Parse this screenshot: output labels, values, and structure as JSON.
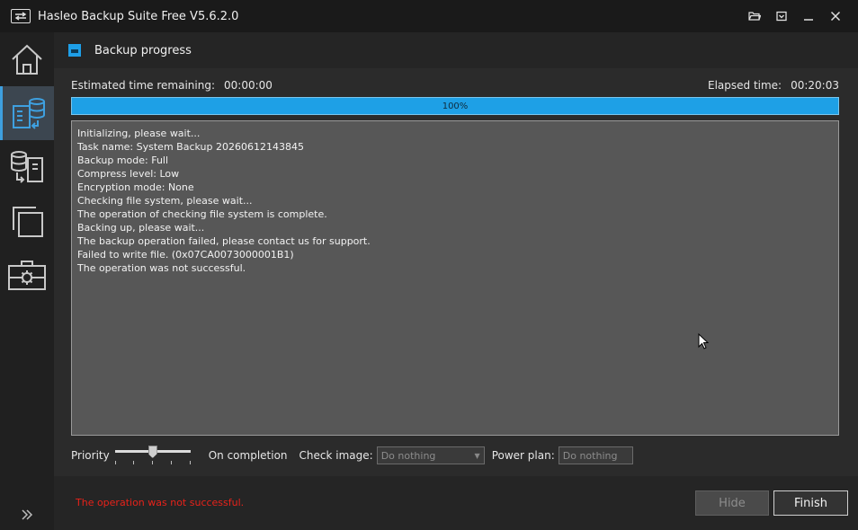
{
  "window": {
    "title": "Hasleo Backup Suite Free V5.6.2.0",
    "icons": [
      "open-folder-icon",
      "maximize-panel-icon",
      "minimize-icon",
      "close-icon"
    ]
  },
  "sidebar": {
    "items": [
      {
        "name": "home",
        "icon": "home-icon",
        "active": false
      },
      {
        "name": "backup",
        "icon": "backup-icon",
        "active": true
      },
      {
        "name": "restore",
        "icon": "restore-icon",
        "active": false
      },
      {
        "name": "clone",
        "icon": "clone-icon",
        "active": false
      },
      {
        "name": "tools",
        "icon": "toolbox-icon",
        "active": false
      }
    ],
    "expand_icon": "double-chevron-right-icon"
  },
  "panel": {
    "title": "Backup progress"
  },
  "progress": {
    "remaining_label": "Estimated time remaining:",
    "remaining_value": "00:00:00",
    "elapsed_label": "Elapsed time:",
    "elapsed_value": "00:20:03",
    "percent_text": "100%",
    "fraction": 1.0,
    "color": "#1ea0e6"
  },
  "log": {
    "lines": [
      "Initializing, please wait...",
      "Task name: System Backup 20260612143845",
      "Backup mode: Full",
      "Compress level: Low",
      "Encryption mode: None",
      "Checking file system, please wait...",
      "The operation of checking file system is complete.",
      "Backing up, please wait...",
      "The backup operation failed, please contact us for support.",
      "Failed to write file. (0x07CA0073000001B1)",
      "The operation was not successful."
    ]
  },
  "options": {
    "priority_label": "Priority",
    "priority_level": 0.5,
    "completion_label": "On completion",
    "check_image_label": "Check image:",
    "check_image_value": "Do nothing",
    "power_plan_label": "Power plan:",
    "power_plan_value": "Do nothing"
  },
  "footer": {
    "status_text": "The operation was not successful.",
    "status_color": "#e8221a",
    "hide_label": "Hide",
    "finish_label": "Finish"
  }
}
